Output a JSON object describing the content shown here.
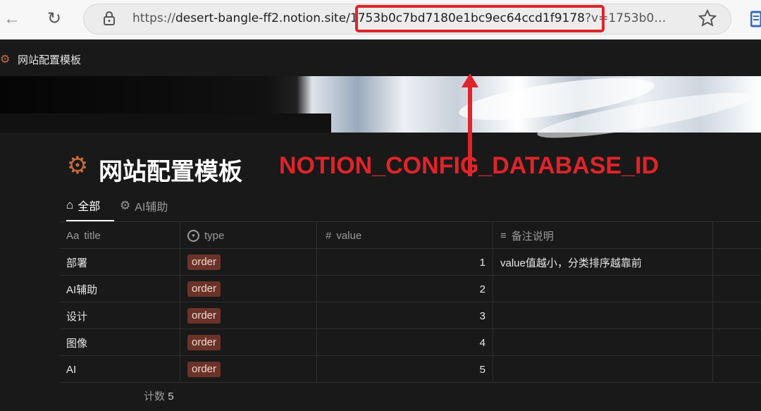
{
  "browser": {
    "url_prefix": "https://",
    "url_host": "desert-bangle-ff2.notion.site",
    "url_path": "/1753b0c7bd7180e1bc9ec64ccd1f9178",
    "url_query": "?v=1753b0…",
    "highlight_color": "#e0242a"
  },
  "breadcrumb": {
    "label": "网站配置模板"
  },
  "page": {
    "title": "网站配置模板",
    "annotation": "NOTION_CONFIG_DATABASE_ID",
    "annotation_color": "#e0242a"
  },
  "tabs": [
    {
      "label": "全部",
      "icon": "home-icon"
    },
    {
      "label": "AI辅助",
      "icon": "gear-icon"
    }
  ],
  "table": {
    "headers": [
      {
        "label": "title",
        "prefix": "Aa"
      },
      {
        "label": "type",
        "icon": "select-icon"
      },
      {
        "label": "value",
        "icon": "hash-icon"
      },
      {
        "label": "备注说明",
        "icon": "lines-icon"
      }
    ],
    "rows": [
      {
        "title": "部署",
        "type": "order",
        "value": "1",
        "note": "value值越小，分类排序越靠前"
      },
      {
        "title": "AI辅助",
        "type": "order",
        "value": "2",
        "note": ""
      },
      {
        "title": "设计",
        "type": "order",
        "value": "3",
        "note": ""
      },
      {
        "title": "图像",
        "type": "order",
        "value": "4",
        "note": ""
      },
      {
        "title": "AI",
        "type": "order",
        "value": "5",
        "note": ""
      }
    ],
    "count_label": "计数",
    "count_value": "5"
  },
  "colors": {
    "background": "#191919",
    "tag_bg": "#6b3328",
    "accent": "#c76c3b"
  }
}
